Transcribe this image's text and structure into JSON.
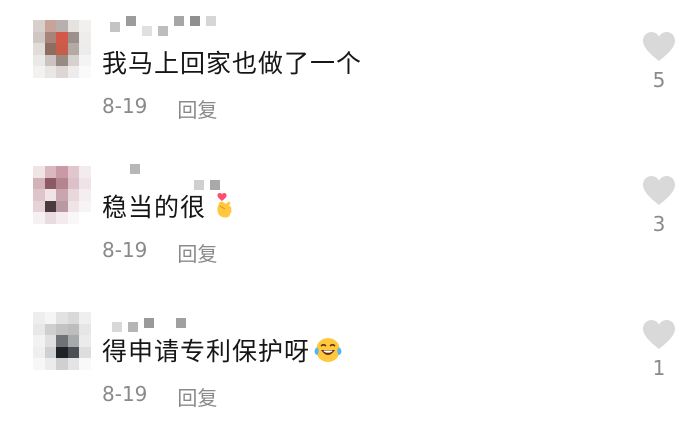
{
  "comments": [
    {
      "text": "我马上回家也做了一个",
      "emoji": "",
      "date": "8-19",
      "reply_label": "回复",
      "like_count": "5"
    },
    {
      "text": "稳当的很",
      "emoji": "finger-heart-emoji",
      "date": "8-19",
      "reply_label": "回复",
      "like_count": "3"
    },
    {
      "text": "得申请专利保护呀",
      "emoji": "laughing-tears-emoji",
      "date": "8-19",
      "reply_label": "回复",
      "like_count": "1"
    }
  ],
  "colors": {
    "text": "#161616",
    "meta": "#8a8a8a",
    "heart": "#d9d9d9"
  }
}
